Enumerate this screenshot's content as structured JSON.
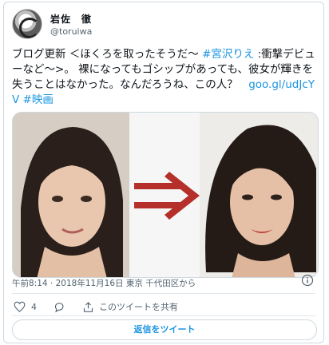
{
  "user": {
    "display_name": "岩佐　徹",
    "handle": "@toruiwa"
  },
  "tweet": {
    "text_part1": "ブログ更新 ＜ほくろを取ったそうだ～ ",
    "hashtag1": "#宮沢りえ",
    "text_part2": " :衝撃デビューなど～>。 裸になってもゴシップがあっても、彼女が輝きを失うことはなかった。なんだろうね、この人？　",
    "link": "goo.gl/udJcYV",
    "hashtag2": "#映画"
  },
  "media": {
    "description_left": "before",
    "description_right": "after"
  },
  "meta": {
    "timestamp": "午前8:14 · 2018年11月16日 東京 千代田区から"
  },
  "actions": {
    "like_count": "4",
    "share_label": "このツイートを共有"
  },
  "reply_button_label": "返信をツイート",
  "colors": {
    "link": "#1b95e0",
    "arrow": "#b5302a"
  }
}
